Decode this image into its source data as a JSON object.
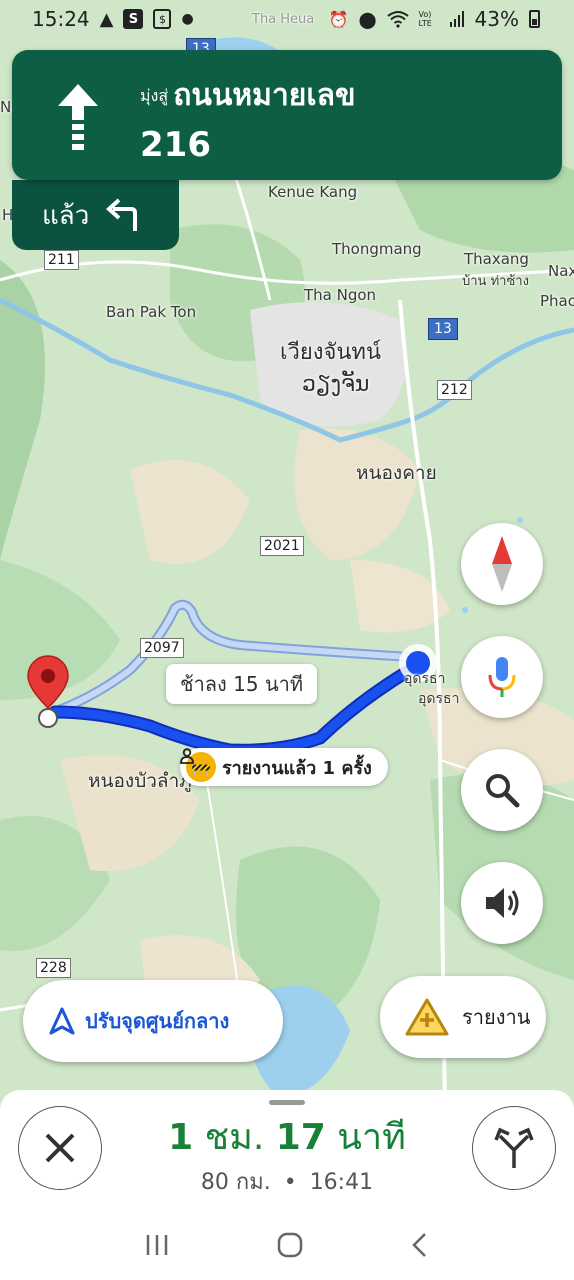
{
  "status_bar": {
    "time": "15:24",
    "battery": "43%",
    "volte": "Vo) LTE"
  },
  "map": {
    "places": {
      "tha_heua": "Tha Heua",
      "kenue_kang": "Kenue Kang",
      "thongmang": "Thongmang",
      "thaxang": "Thaxang",
      "thaxang_thai": "บ้าน ท่าซ้าง",
      "tha_ngon": "Tha Ngon",
      "ban_pak_ton": "Ban Pak Ton",
      "vientiane_thai": "เวียงจันทน์",
      "vientiane_lao": "ວຽງຈັນ",
      "nong_khai": "หนองคาย",
      "nong_bua": "หนองบัวลำภู",
      "udon_label": "อุดรธา",
      "udon_label_2": "อุดรธา",
      "edge_na": "Na",
      "edge_h": "H",
      "edge_nax": "Nax",
      "edge_phac": "Phac"
    },
    "shields": {
      "r13_top": "13",
      "r211": "211",
      "r13": "13",
      "r212": "212",
      "r2021": "2021",
      "r2097": "2097",
      "r228": "228"
    },
    "route_delay": "ช้าลง 15 นาที",
    "report_chip": "รายงานแล้ว 1 ครั้ง"
  },
  "navigation": {
    "toward": "มุ่งสู่",
    "road_name": "ถนนหมายเลข",
    "road_number": "216",
    "then_label": "แล้ว",
    "maneuver_icon": "straight-arrow-icon",
    "next_maneuver_icon": "turn-left-icon"
  },
  "buttons": {
    "recenter": "ปรับจุดศูนย์กลาง",
    "report": "รายงาน"
  },
  "trip": {
    "hours": "1",
    "hours_unit": "ชม.",
    "minutes": "17",
    "minutes_unit": "นาที",
    "distance": "80 กม.",
    "separator": "•",
    "arrival": "16:41"
  },
  "colors": {
    "banner_green": "#0e5e45",
    "route_blue": "#1a4ff0",
    "alt_route": "#a9c3ef",
    "eta_green": "#188038",
    "pin_red": "#e53935"
  }
}
